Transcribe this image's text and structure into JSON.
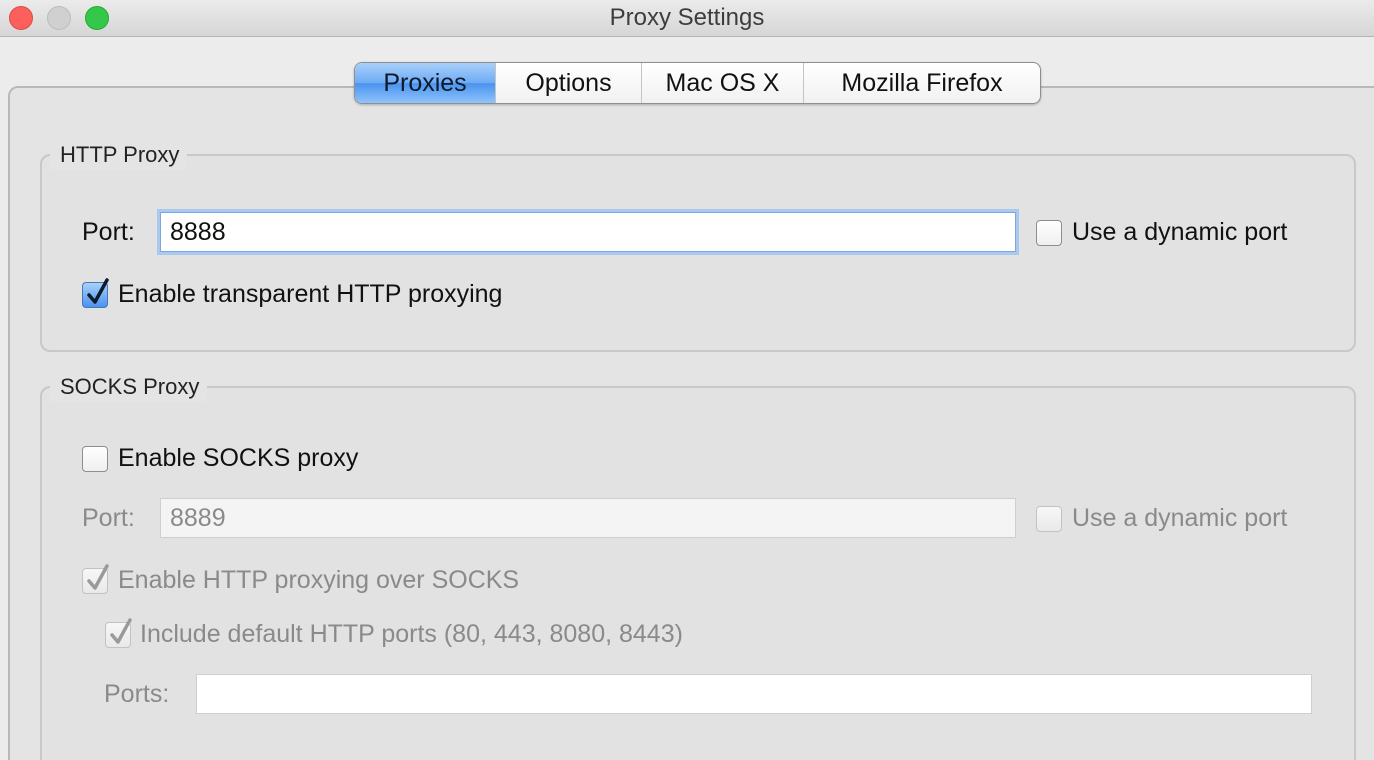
{
  "window": {
    "title": "Proxy Settings"
  },
  "tabs": [
    {
      "label": "Proxies",
      "active": true
    },
    {
      "label": "Options",
      "active": false
    },
    {
      "label": "Mac OS X",
      "active": false
    },
    {
      "label": "Mozilla Firefox",
      "active": false
    }
  ],
  "http_proxy": {
    "title": "HTTP Proxy",
    "port_label": "Port:",
    "port_value": "8888",
    "dynamic_port_label": "Use a dynamic port",
    "dynamic_port_checked": false,
    "transparent_label": "Enable transparent HTTP proxying",
    "transparent_checked": true
  },
  "socks_proxy": {
    "title": "SOCKS Proxy",
    "enable_label": "Enable SOCKS proxy",
    "enable_checked": false,
    "port_label": "Port:",
    "port_value": "8889",
    "dynamic_port_label": "Use a dynamic port",
    "dynamic_port_checked": false,
    "http_over_socks_label": "Enable HTTP proxying over SOCKS",
    "http_over_socks_checked": true,
    "include_default_ports_label": "Include default HTTP ports (80, 443, 8080, 8443)",
    "include_default_ports_checked": true,
    "ports_label": "Ports:",
    "ports_value": ""
  },
  "colors": {
    "active_tab": "#4a93ef",
    "focus_ring": "#a9c9f1",
    "checkmark": "#0d1b2e",
    "disabled_text": "#8a8a8a"
  }
}
